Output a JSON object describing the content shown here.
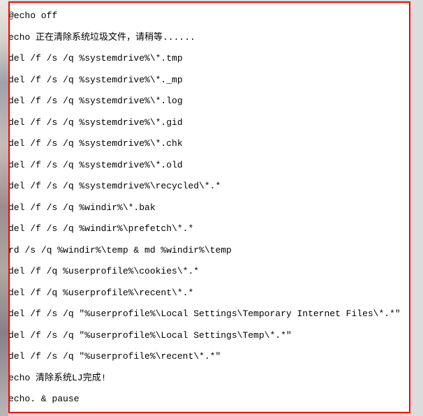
{
  "code": {
    "lines": [
      "@echo off",
      "echo 正在清除系统垃圾文件，请稍等......",
      "del /f /s /q %systemdrive%\\*.tmp",
      "del /f /s /q %systemdrive%\\*._mp",
      "del /f /s /q %systemdrive%\\*.log",
      "del /f /s /q %systemdrive%\\*.gid",
      "del /f /s /q %systemdrive%\\*.chk",
      "del /f /s /q %systemdrive%\\*.old",
      "del /f /s /q %systemdrive%\\recycled\\*.*",
      "del /f /s /q %windir%\\*.bak",
      "del /f /s /q %windir%\\prefetch\\*.*",
      "rd /s /q %windir%\\temp & md %windir%\\temp",
      "del /f /q %userprofile%\\cookies\\*.*",
      "del /f /q %userprofile%\\recent\\*.*",
      "del /f /s /q \"%userprofile%\\Local Settings\\Temporary Internet Files\\*.*\"",
      "del /f /s /q \"%userprofile%\\Local Settings\\Temp\\*.*\"",
      "del /f /s /q \"%userprofile%\\recent\\*.*\"",
      "echo 清除系统LJ完成!",
      "echo. & pause"
    ]
  }
}
